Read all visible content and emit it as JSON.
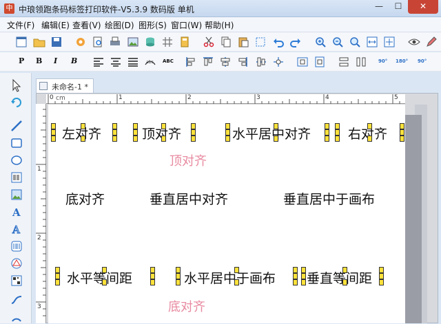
{
  "window": {
    "title": "中琅领跑条码标签打印软件-V5.3.9 数码版 单机",
    "min": "—",
    "max": "☐",
    "close": "✕"
  },
  "menu": [
    {
      "label": "文件(F)"
    },
    {
      "label": "编辑(E)"
    },
    {
      "label": "查看(V)"
    },
    {
      "label": "绘图(D)"
    },
    {
      "label": "图形(S)"
    },
    {
      "label": "窗口(W)"
    },
    {
      "label": "帮助(H)"
    }
  ],
  "toolbar2_glyphs": {
    "p": "P",
    "b": "B",
    "i": "I",
    "b_italic": "B",
    "abc": "ABC",
    "rot90": "90°",
    "rot180": "180°",
    "rot270": "90°"
  },
  "doc_tab": {
    "label": "未命名-1 *"
  },
  "ruler": {
    "unit": "cm",
    "h_ticks": [
      "0",
      "1",
      "2",
      "3",
      "4",
      "5"
    ],
    "v_ticks": [
      "1",
      "2",
      "3"
    ]
  },
  "canvas": {
    "labels": {
      "left_align": "左对齐",
      "top_align": "顶对齐",
      "h_center": "水平居中对齐",
      "right_align": "右对齐",
      "top_align_ghost": "顶对齐",
      "bottom_align": "底对齐",
      "v_center": "垂直居中对齐",
      "v_center_canvas": "垂直居中于画布",
      "h_spacing": "水平等间距",
      "h_center_canvas": "水平居中于画布",
      "v_spacing": "垂直等间距",
      "bottom_align_ghost": "底对齐"
    }
  }
}
